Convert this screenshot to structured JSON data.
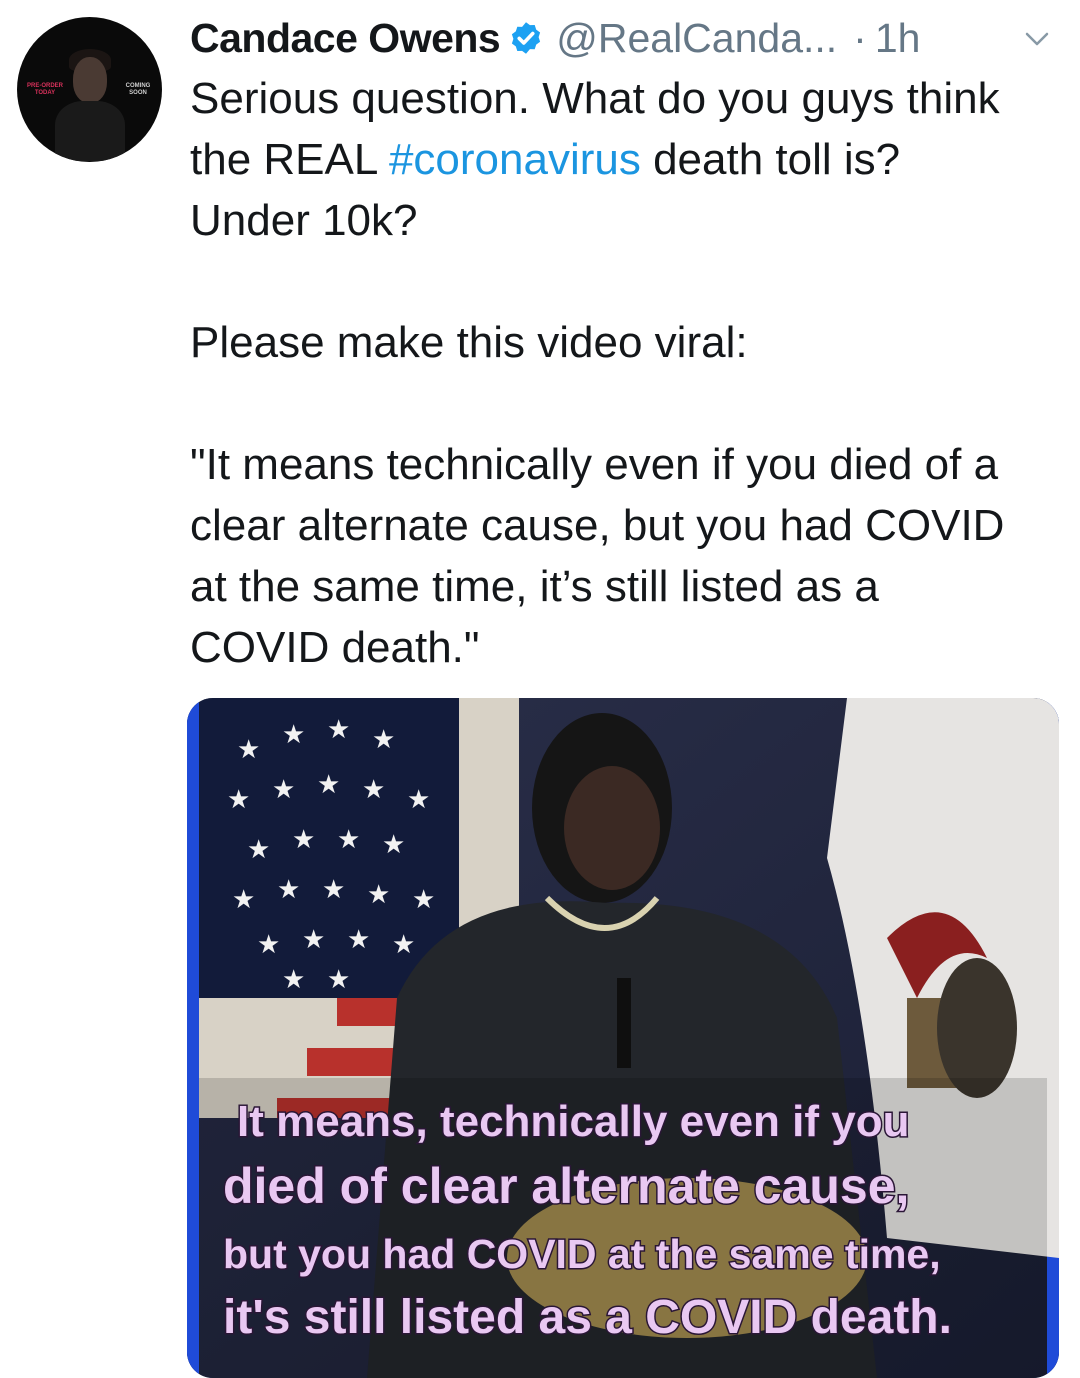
{
  "tweet": {
    "author_name": "Candace Owens",
    "handle": "@RealCanda...",
    "separator": "·",
    "time_ago": "1h",
    "line1": "Serious question. What do you guys think",
    "line2_before": "the REAL ",
    "hashtag": "#coronavirus",
    "line2_after": " death toll is?",
    "line3": "Under 10k?",
    "para2": "Please make this video viral:",
    "quote_lines": [
      "\"It means technically even if you died of a",
      "clear alternate cause, but you had COVID",
      "at the same time, it’s still listed as a",
      "COVID death.\""
    ]
  },
  "avatar": {
    "left_text": "PRE-ORDER TODAY",
    "right_text": "COMING SOON"
  },
  "video": {
    "caption_lines": [
      "It means, technically even if you",
      "died of clear alternate cause,",
      "but you had COVID at the same time,",
      "it's still listed as a COVID death."
    ]
  },
  "colors": {
    "link": "#1b95e0",
    "verified": "#1da1f2",
    "meta": "#657786",
    "caption": "#e9c8f2"
  },
  "icons": {
    "verified": "verified-badge-icon",
    "menu": "chevron-down-icon"
  }
}
